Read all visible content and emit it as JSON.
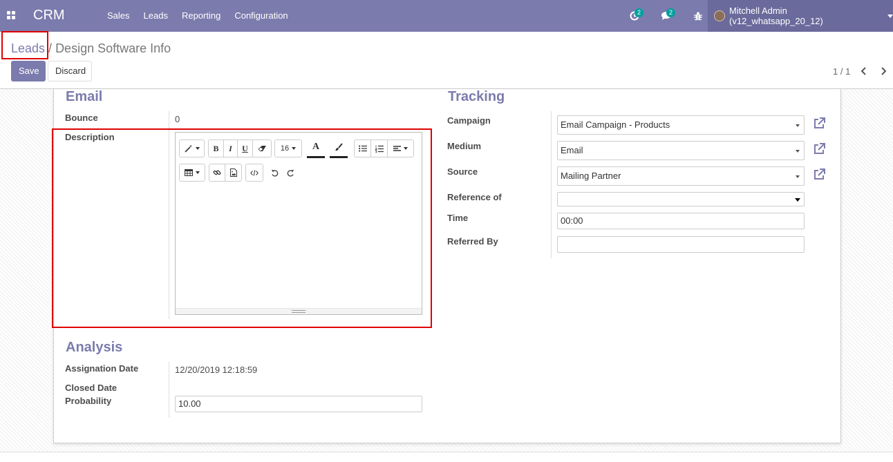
{
  "navbar": {
    "brand": "CRM",
    "menu": [
      "Sales",
      "Leads",
      "Reporting",
      "Configuration"
    ],
    "activity_count": "2",
    "messages_count": "2",
    "user_name": "Mitchell Admin (v12_whatsapp_20_12)",
    "color": "#7c7bad"
  },
  "breadcrumb": {
    "parent": "Leads",
    "separator": " / ",
    "current": "Design Software Info"
  },
  "buttons": {
    "save": "Save",
    "discard": "Discard"
  },
  "pager": {
    "value": "1 / 1"
  },
  "email_section": {
    "title": "Email",
    "bounce_label": "Bounce",
    "bounce_value": "0",
    "description_label": "Description"
  },
  "editor_toolbar": {
    "font_size": "16",
    "bold": "B",
    "italic": "I",
    "underline": "U",
    "text_color_glyph": "A"
  },
  "tracking_section": {
    "title": "Tracking",
    "campaign_label": "Campaign",
    "campaign_value": "Email Campaign - Products",
    "medium_label": "Medium",
    "medium_value": "Email",
    "source_label": "Source",
    "source_value": "Mailing Partner",
    "reference_label": "Reference of",
    "reference_value": "",
    "time_label": "Time",
    "time_value": "00:00",
    "referred_label": "Referred By",
    "referred_value": ""
  },
  "analysis_section": {
    "title": "Analysis",
    "assignation_label": "Assignation Date",
    "assignation_value": "12/20/2019 12:18:59",
    "closed_label": "Closed Date",
    "probability_label": "Probability",
    "probability_value": "10.00"
  },
  "colors": {
    "highlight": "#e00000",
    "accent": "#7c7bad",
    "badge": "#00a09d"
  }
}
